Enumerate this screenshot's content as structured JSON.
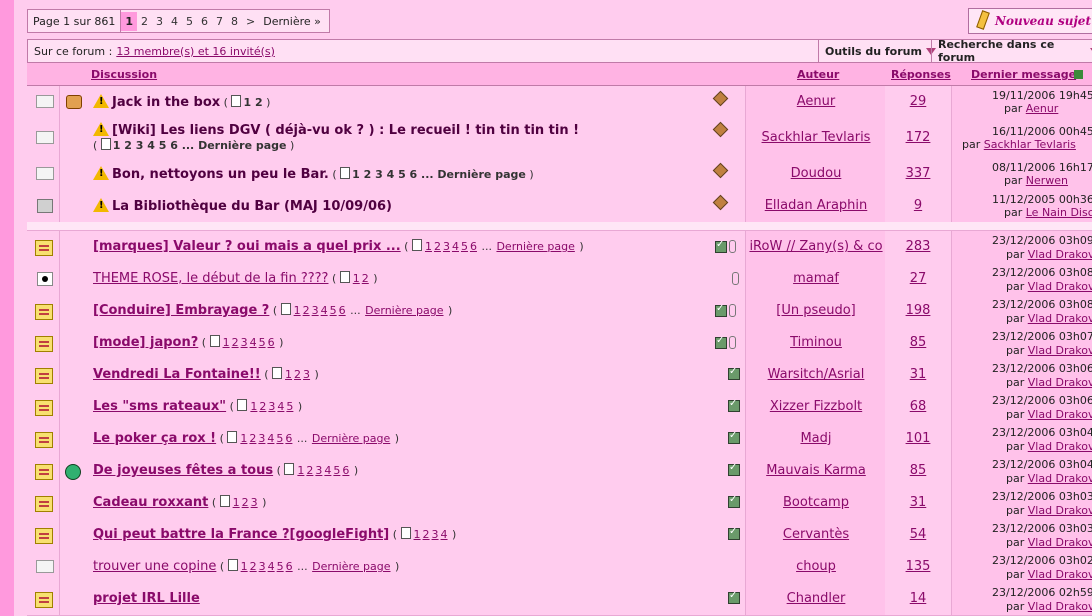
{
  "pager": {
    "info": "Page 1 sur 861",
    "current": "1",
    "pages": [
      "2",
      "3",
      "4",
      "5",
      "6",
      "7",
      "8"
    ],
    "next": ">",
    "last": "Dernière »"
  },
  "new_topic_label": "Nouveau sujet",
  "infobar": {
    "label": "Sur ce forum :",
    "members_link": "13 membre(s) et 16 invité(s)",
    "tools": "Outils du forum",
    "search": "Recherche dans ce forum"
  },
  "header": {
    "discussion": "Discussion",
    "author": "Auteur",
    "replies": "Réponses",
    "last": "Dernier message"
  },
  "sticky_rows": [
    {
      "title": "Jack in the box",
      "pages": "1 2",
      "author": "Aenur",
      "replies": "29",
      "last_date": "19/11/2006 19h45",
      "last_by": "Aenur",
      "icon2": "thumb"
    },
    {
      "title": "[Wiki] Les liens DGV ( déjà-vu ok ? ) : Le recueil ! tin tin tin tin !",
      "pages": "1 2 3 4 5 6 ... Dernière page",
      "author": "Sackhlar Tevlaris",
      "replies": "172",
      "last_date": "16/11/2006 00h45",
      "last_by": "Sackhlar Tevlaris",
      "icon2": ""
    },
    {
      "title": "Bon, nettoyons un peu le Bar.",
      "pages": "1 2 3 4 5 6 ... Dernière page",
      "author": "Doudou",
      "replies": "337",
      "last_date": "08/11/2006 16h17",
      "last_by": "Nerwen",
      "icon2": ""
    },
    {
      "title": "La Bibliothèque du Bar (MAJ 10/09/06)",
      "pages": "",
      "author": "Elladan Araphin",
      "replies": "9",
      "last_date": "11/12/2005 00h36",
      "last_by": "Le Nain Disco",
      "icon2": ""
    }
  ],
  "rows": [
    {
      "title": "[marques] Valeur ? oui mais a quel prix ...",
      "pages": [
        "1",
        "2",
        "3",
        "4",
        "5",
        "6"
      ],
      "more": "Dernière page",
      "author": "iRoW // Zany(s) & co",
      "replies": "283",
      "last_date": "23/12/2006 03h09",
      "last_by": "Vlad Drakov",
      "icon": "env-y",
      "icon2": "",
      "bold": true,
      "chk": true,
      "clip": true
    },
    {
      "title": "THEME ROSE, le début de la fin ????",
      "pages": [
        "1",
        "2"
      ],
      "more": "",
      "author": "mamaf",
      "replies": "27",
      "last_date": "23/12/2006 03h08",
      "last_by": "Vlad Drakov",
      "icon": "dot",
      "icon2": "",
      "bold": false,
      "chk": false,
      "clip": true
    },
    {
      "title": "[Conduire] Embrayage ?",
      "pages": [
        "1",
        "2",
        "3",
        "4",
        "5",
        "6"
      ],
      "more": "Dernière page",
      "author": "[Un pseudo]",
      "replies": "198",
      "last_date": "23/12/2006 03h08",
      "last_by": "Vlad Drakov",
      "icon": "env-y",
      "icon2": "",
      "bold": true,
      "chk": true,
      "clip": true
    },
    {
      "title": "[mode] japon?",
      "pages": [
        "1",
        "2",
        "3",
        "4",
        "5",
        "6"
      ],
      "more": "",
      "author": "Timinou",
      "replies": "85",
      "last_date": "23/12/2006 03h07",
      "last_by": "Vlad Drakov",
      "icon": "env-y",
      "icon2": "",
      "bold": true,
      "chk": true,
      "clip": true
    },
    {
      "title": "Vendredi La Fontaine!!",
      "pages": [
        "1",
        "2",
        "3"
      ],
      "more": "",
      "author": "Warsitch/Asrial",
      "replies": "31",
      "last_date": "23/12/2006 03h06",
      "last_by": "Vlad Drakov",
      "icon": "env-y",
      "icon2": "",
      "bold": true,
      "chk": true,
      "clip": false
    },
    {
      "title": "Les \"sms rateaux\"",
      "pages": [
        "1",
        "2",
        "3",
        "4",
        "5"
      ],
      "more": "",
      "author": "Xizzer Fizzbolt",
      "replies": "68",
      "last_date": "23/12/2006 03h06",
      "last_by": "Vlad Drakov",
      "icon": "env-y",
      "icon2": "",
      "bold": true,
      "chk": true,
      "clip": false
    },
    {
      "title": "Le poker ça rox !",
      "pages": [
        "1",
        "2",
        "3",
        "4",
        "5",
        "6"
      ],
      "more": "Dernière page",
      "author": "Madj",
      "replies": "101",
      "last_date": "23/12/2006 03h04",
      "last_by": "Vlad Drakov",
      "icon": "env-y",
      "icon2": "",
      "bold": true,
      "chk": true,
      "clip": false
    },
    {
      "title": "De joyeuses fêtes a tous",
      "pages": [
        "1",
        "2",
        "3",
        "4",
        "5",
        "6"
      ],
      "more": "",
      "author": "Mauvais Karma",
      "replies": "85",
      "last_date": "23/12/2006 03h04",
      "last_by": "Vlad Drakov",
      "icon": "env-y",
      "icon2": "smile",
      "bold": true,
      "chk": true,
      "clip": false
    },
    {
      "title": "Cadeau roxxant",
      "pages": [
        "1",
        "2",
        "3"
      ],
      "more": "",
      "author": "Bootcamp",
      "replies": "31",
      "last_date": "23/12/2006 03h03",
      "last_by": "Vlad Drakov",
      "icon": "env-y",
      "icon2": "",
      "bold": true,
      "chk": true,
      "clip": false
    },
    {
      "title": "Qui peut battre la France ?[googleFight]",
      "pages": [
        "1",
        "2",
        "3",
        "4"
      ],
      "more": "",
      "author": "Cervantès",
      "replies": "54",
      "last_date": "23/12/2006 03h03",
      "last_by": "Vlad Drakov",
      "icon": "env-y",
      "icon2": "",
      "bold": true,
      "chk": true,
      "clip": false
    },
    {
      "title": "trouver une copine",
      "pages": [
        "1",
        "2",
        "3",
        "4",
        "5",
        "6"
      ],
      "more": "Dernière page",
      "author": "choup",
      "replies": "135",
      "last_date": "23/12/2006 03h02",
      "last_by": "Vlad Drakov",
      "icon": "env",
      "icon2": "",
      "bold": false,
      "chk": false,
      "clip": false
    },
    {
      "title": "projet IRL Lille",
      "pages": [],
      "more": "",
      "author": "Chandler",
      "replies": "14",
      "last_date": "23/12/2006 02h59",
      "last_by": "Vlad Drakov",
      "icon": "env-y",
      "icon2": "",
      "bold": true,
      "chk": true,
      "clip": false
    }
  ],
  "by_label": "par"
}
